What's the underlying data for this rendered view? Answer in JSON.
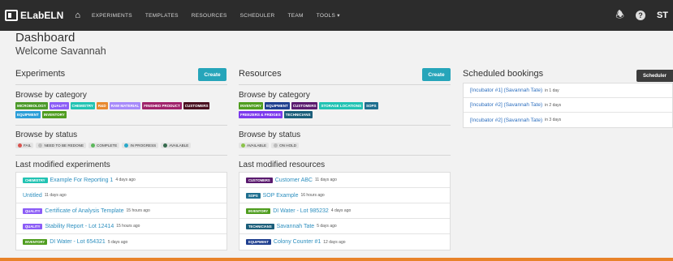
{
  "nav": {
    "brand": "ELabELN",
    "items": [
      "EXPERIMENTS",
      "TEMPLATES",
      "RESOURCES",
      "SCHEDULER",
      "TEAM",
      "TOOLS ▾"
    ],
    "avatar": "ST",
    "help": "?"
  },
  "page": {
    "title": "Dashboard",
    "welcome": "Welcome Savannah"
  },
  "experiments": {
    "title": "Experiments",
    "create": "Create",
    "by_category": "Browse by category",
    "categories": [
      {
        "label": "MICROBIOLOGY",
        "color": "#4c9a2a"
      },
      {
        "label": "QUALITY",
        "color": "#8b5cf6"
      },
      {
        "label": "CHEMISTRY",
        "color": "#22c3b3"
      },
      {
        "label": "R&D",
        "color": "#e8892f"
      },
      {
        "label": "RAW MATERIAL",
        "color": "#a78bfa"
      },
      {
        "label": "FINISHED PRODUCT",
        "color": "#a0236b"
      },
      {
        "label": "CUSTOMERS",
        "color": "#4a1020"
      },
      {
        "label": "EQUIPMENT",
        "color": "#2d9fd8"
      },
      {
        "label": "INVENTORY",
        "color": "#4f9d1f"
      }
    ],
    "by_status": "Browse by status",
    "statuses": [
      {
        "label": "FAIL",
        "color": "#d9534f"
      },
      {
        "label": "NEED TO BE REDONE",
        "color": "#bbbbbb"
      },
      {
        "label": "COMPLETE",
        "color": "#5cb85c"
      },
      {
        "label": "IN PROGRESS",
        "color": "#29a9c9"
      },
      {
        "label": "AVAILABLE",
        "color": "#356a4d"
      }
    ],
    "last_modified": "Last modified experiments",
    "items": [
      {
        "tag": "CHEMISTRY",
        "tag_color": "#22c3b3",
        "name": "Example For Reporting 1",
        "time": "4 days ago"
      },
      {
        "tag": "",
        "tag_color": "",
        "name": "Untitled",
        "time": "11 days ago"
      },
      {
        "tag": "QUALITY",
        "tag_color": "#8b5cf6",
        "name": "Certificate of Analysis Template",
        "time": "15 hours ago"
      },
      {
        "tag": "QUALITY",
        "tag_color": "#8b5cf6",
        "name": "Stability Report - Lot 12414",
        "time": "15 hours ago"
      },
      {
        "tag": "INVENTORY",
        "tag_color": "#4f9d1f",
        "name": "DI Water - Lot 654321",
        "time": "5 days ago"
      }
    ]
  },
  "resources": {
    "title": "Resources",
    "create": "Create",
    "by_category": "Browse by category",
    "categories": [
      {
        "label": "INVENTORY",
        "color": "#4f9d1f"
      },
      {
        "label": "EQUIPMENT",
        "color": "#1f3f8f"
      },
      {
        "label": "CUSTOMERS",
        "color": "#5a1a6e"
      },
      {
        "label": "STORAGE LOCATIONS",
        "color": "#22c3b3"
      },
      {
        "label": "SOPS",
        "color": "#1f6f8f"
      },
      {
        "label": "FREEZERS & FRIDGES",
        "color": "#7c3aed"
      },
      {
        "label": "TECHNICIANS",
        "color": "#1b5e7a"
      }
    ],
    "by_status": "Browse by status",
    "statuses": [
      {
        "label": "AVAILABLE",
        "color": "#8bc34a"
      },
      {
        "label": "ON HOLD",
        "color": "#bbbbbb"
      }
    ],
    "last_modified": "Last modified resources",
    "items": [
      {
        "tag": "CUSTOMERS",
        "tag_color": "#5a1a6e",
        "name": "Customer ABC",
        "time": "11 days ago"
      },
      {
        "tag": "SOPS",
        "tag_color": "#1f6f8f",
        "name": "SOP Example",
        "time": "16 hours ago"
      },
      {
        "tag": "INVENTORY",
        "tag_color": "#4f9d1f",
        "name": "DI Water - Lot 985232",
        "time": "4 days ago"
      },
      {
        "tag": "TECHNICIANS",
        "tag_color": "#1b5e7a",
        "name": "Savannah Tate",
        "time": "5 days ago"
      },
      {
        "tag": "EQUIPMENT",
        "tag_color": "#1f3f8f",
        "name": "Colony Counter #1",
        "time": "12 days ago"
      }
    ]
  },
  "bookings": {
    "title": "Scheduled bookings",
    "scheduler": "Scheduler",
    "items": [
      {
        "name": "[Incubator #1] (Savannah Tate)",
        "time": "in 1 day"
      },
      {
        "name": "[Incubator #2] (Savannah Tate)",
        "time": "in 2 days"
      },
      {
        "name": "[Incubator #2] (Savannah Tate)",
        "time": "in 3 days"
      }
    ]
  }
}
